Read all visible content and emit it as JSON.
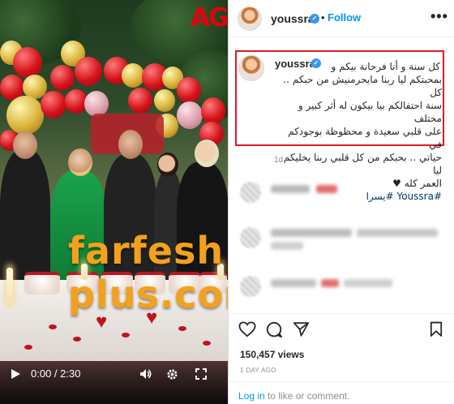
{
  "video": {
    "brand_logo": "AG",
    "watermark": "farfesh plus.com",
    "time_display": "0:00 / 2:30",
    "play_icon": "play-icon",
    "volume_icon": "volume-icon",
    "settings_icon": "gear-icon",
    "fullscreen_icon": "fullscreen-icon"
  },
  "post": {
    "username": "youssra",
    "follow_label": "Follow",
    "more_label": "•••",
    "caption_username": "youssra",
    "caption_lines": [
      "كل سنة و أنا فرحانة بيكم و",
      "بمحبتكم ليا ربنا مايحرمنيش من حبكم .. كل",
      "سنة احتفالكم بيا بيكون له أثر كبير و مختلف",
      "على قلبي سعيدة و محظوظة بوجودكم في",
      "حياتي .. بحبكم من كل قلبي ربنا يخليكم ليا",
      "العمر كله ♥"
    ],
    "hashtags": "#Youssra #يسرا",
    "caption_age": "1d",
    "views": "150,457 views",
    "posted_ago": "1 DAY AGO",
    "login_link": "Log in",
    "login_suffix": " to like or comment."
  },
  "colors": {
    "accent_blue": "#0095f6",
    "verified_blue": "#3897f0",
    "highlight_red": "#e01922",
    "hashtag_blue": "#00376b",
    "watermark_orange": "#f3a11c",
    "logo_red": "#e3000f"
  }
}
